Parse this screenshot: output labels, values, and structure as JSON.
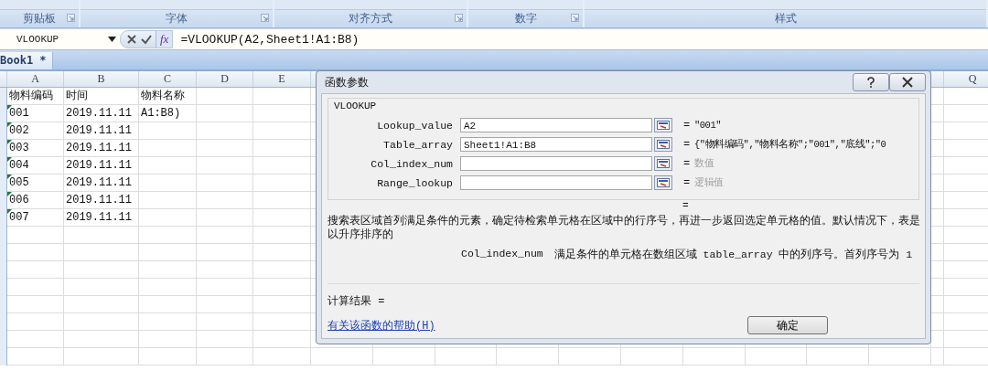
{
  "ribbon_groups": [
    {
      "label": "剪贴板",
      "launcher": true
    },
    {
      "label": "字体",
      "launcher": true
    },
    {
      "label": "对齐方式",
      "launcher": true
    },
    {
      "label": "数字",
      "launcher": true
    },
    {
      "label": "样式",
      "launcher": false
    }
  ],
  "formula_bar": {
    "name_box": "VLOOKUP",
    "fx": "fx",
    "formula": "=VLOOKUP(A2,Sheet1!A1:B8)"
  },
  "workbook_tabs": [
    {
      "label": "Book1 *",
      "selected": true
    }
  ],
  "sheet": {
    "columns": [
      {
        "label": "A"
      },
      {
        "label": "B"
      },
      {
        "label": "C"
      },
      {
        "label": "D"
      },
      {
        "label": "E"
      }
    ],
    "far_column": {
      "label": "Q"
    },
    "rows": [
      {
        "cells": [
          "物料编码",
          "时间",
          "物料名称"
        ],
        "flagged": false
      },
      {
        "cells": [
          "001",
          "2019.11.11",
          "A1:B8)"
        ],
        "flagged": true
      },
      {
        "cells": [
          "002",
          "2019.11.11"
        ],
        "flagged": true
      },
      {
        "cells": [
          "003",
          "2019.11.11"
        ],
        "flagged": true
      },
      {
        "cells": [
          "004",
          "2019.11.11"
        ],
        "flagged": true
      },
      {
        "cells": [
          "005",
          "2019.11.11"
        ],
        "flagged": true
      },
      {
        "cells": [
          "006",
          "2019.11.11"
        ],
        "flagged": true
      },
      {
        "cells": [
          "007",
          "2019.11.11"
        ],
        "flagged": true
      }
    ]
  },
  "dialog": {
    "title": "函数参数",
    "function_name": "VLOOKUP",
    "arguments": [
      {
        "label": "Lookup_value",
        "value": "A2",
        "sign": "=",
        "result": "\"001\"",
        "placeholder_result": false
      },
      {
        "label": "Table_array",
        "value": "Sheet1!A1:B8",
        "sign": "=",
        "result": "{\"物料编码\",\"物料名称\";\"001\",\"底线\";\"0",
        "placeholder_result": false
      },
      {
        "label": "Col_index_num",
        "sign": "=",
        "result": "数值",
        "placeholder_result": true
      },
      {
        "label": "Range_lookup",
        "sign": "=",
        "result": "逻辑值",
        "placeholder_result": true
      }
    ],
    "formula_sign": "=",
    "description": "搜索表区域首列满足条件的元素，确定待检索单元格在区域中的行序号，再进一步返回选定单元格的值。默认情况下，表是以升序排序的",
    "argument_help": {
      "name": "Col_index_num",
      "text": "满足条件的单元格在数组区域 table_array 中的列序号。首列序号为 1"
    },
    "result_label": "计算结果 =",
    "help_link": "有关该函数的帮助(H)",
    "buttons": [
      "确定"
    ]
  }
}
